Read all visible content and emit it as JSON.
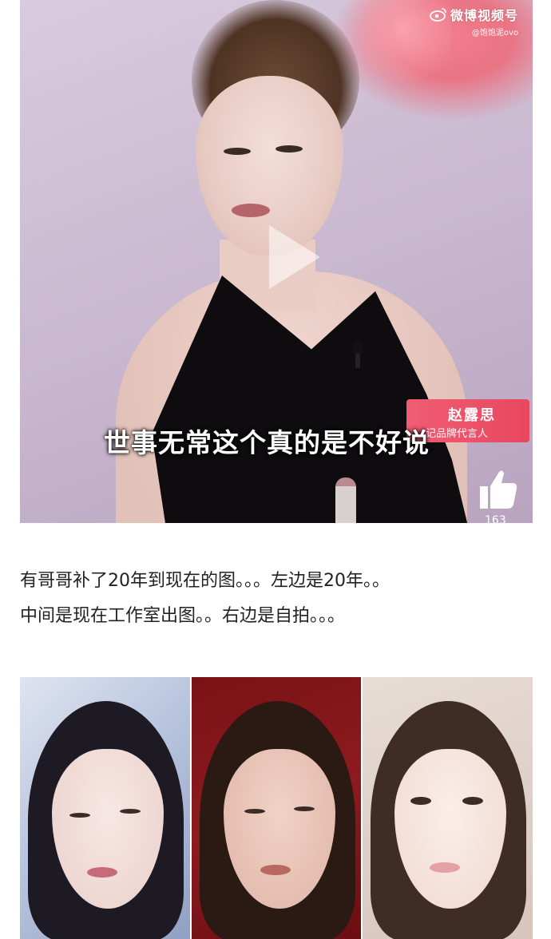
{
  "video": {
    "watermark_title": "微博视频号",
    "watermark_handle": "@饱饱泥ovo",
    "name_card_name": "赵露思",
    "name_card_title": "记品牌代言人",
    "subtitle": "世事无常这个真的是不好说",
    "like_count": "163",
    "accent_color": "#e8475f",
    "icons": [
      "weibo-icon",
      "play-icon",
      "like-icon"
    ]
  },
  "post": {
    "line1": "有哥哥补了20年到现在的图。。。左边是20年。。",
    "line2": "中间是现在工作室出图。。右边是自拍。。。"
  }
}
